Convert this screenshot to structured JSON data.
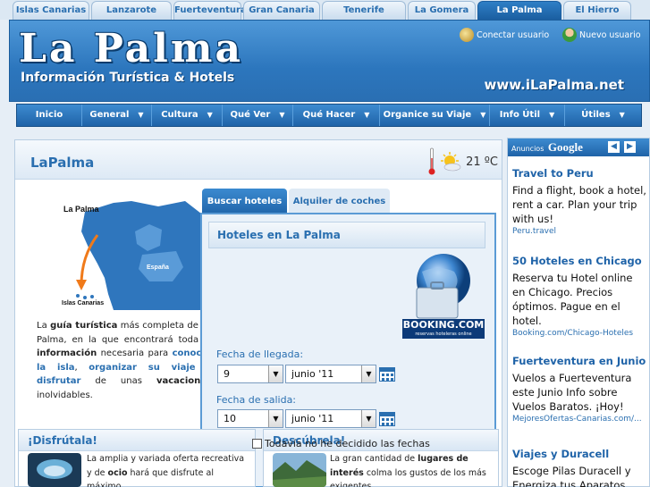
{
  "top_tabs": [
    {
      "label": "Islas Canarias"
    },
    {
      "label": "Lanzarote"
    },
    {
      "label": "Fuerteventura"
    },
    {
      "label": "Gran Canaria"
    },
    {
      "label": "Tenerife"
    },
    {
      "label": "La Gomera"
    },
    {
      "label": "La Palma",
      "active": true
    },
    {
      "label": "El Hierro"
    }
  ],
  "header": {
    "title": "La Palma",
    "subtitle": "Información Turística & Hotels",
    "url": "www.iLaPalma.net",
    "connect_user": "Conectar usuario",
    "new_user": "Nuevo usuario"
  },
  "nav": [
    {
      "label": "Inicio",
      "dropdown": false
    },
    {
      "label": "General",
      "dropdown": true
    },
    {
      "label": "Cultura",
      "dropdown": true
    },
    {
      "label": "Qué Ver",
      "dropdown": true
    },
    {
      "label": "Qué Hacer",
      "dropdown": true
    },
    {
      "label": "Organice su Viaje",
      "dropdown": true
    },
    {
      "label": "Info Útil",
      "dropdown": true
    },
    {
      "label": "Útiles",
      "dropdown": true
    }
  ],
  "main": {
    "title": "LaPalma",
    "temperature": "21 ºC",
    "map_labels": {
      "la_palma": "La Palma",
      "espana": "España",
      "islas": "Islas Canarias"
    },
    "intro": {
      "p1": "La ",
      "b1": "guía turística",
      "p2": " más completa de La Palma, en la que encontrará toda la ",
      "b2": "información",
      "p3": " necesaria para ",
      "l1": "conocer la isla",
      "p4": ", ",
      "l2": "organizar su viaje",
      "p5": " y ",
      "l3": "disfrutar",
      "p6": " de unas ",
      "b3": "vacaciones",
      "p7": " inolvidables."
    }
  },
  "hotel_widget": {
    "tab_hotels": "Buscar hoteles",
    "tab_cars": "Alquiler de coches",
    "title": "Hoteles en La Palma",
    "booking_brand": "BOOKING.COM",
    "booking_tagline": "reservas hoteleras online",
    "arrival_label": "Fecha de llegada:",
    "arrival_day": "9",
    "arrival_month": "junio '11",
    "departure_label": "Fecha de salida:",
    "departure_day": "10",
    "departure_month": "junio '11",
    "undecided": "Todavía no he decidido las fechas"
  },
  "boxes": {
    "enjoy": {
      "title": "¡Disfrútala!",
      "t1": "La amplia y variada oferta recreativa y de ",
      "b1": "ocio",
      "t2": " hará que disfrute al máximo."
    },
    "discover": {
      "title": "Descúbrela!",
      "t1": "La gran cantidad de ",
      "b1": "lugares de interés",
      "t2": " colma los gustos de los más exigentes."
    }
  },
  "ads": {
    "header_prefix": "Anuncios",
    "header_brand": "Google",
    "items": [
      {
        "title": "Travel to Peru",
        "body": "Find a flight, book a hotel, rent a car. Plan your trip with us!",
        "url": "Peru.travel"
      },
      {
        "title": "50 Hoteles en Chicago",
        "body": "Reserva tu Hotel online en Chicago. Precios óptimos. Pague en el hotel.",
        "url": "Booking.com/Chicago-Hoteles"
      },
      {
        "title": "Fuerteventura en Junio",
        "body": "Vuelos a Fuerteventura este Junio Info sobre Vuelos Baratos. ¡Hoy!",
        "url": "MejoresOfertas-Canarias.com/..."
      },
      {
        "title": "Viajes y Duracell",
        "body": "Escoge Pilas Duracell y Energiza tus Aparatos",
        "url": ""
      }
    ]
  },
  "colors": {
    "brand_blue": "#2a6fb0",
    "nav_blue": "#1f63a8",
    "booking_navy": "#0c3a78"
  }
}
